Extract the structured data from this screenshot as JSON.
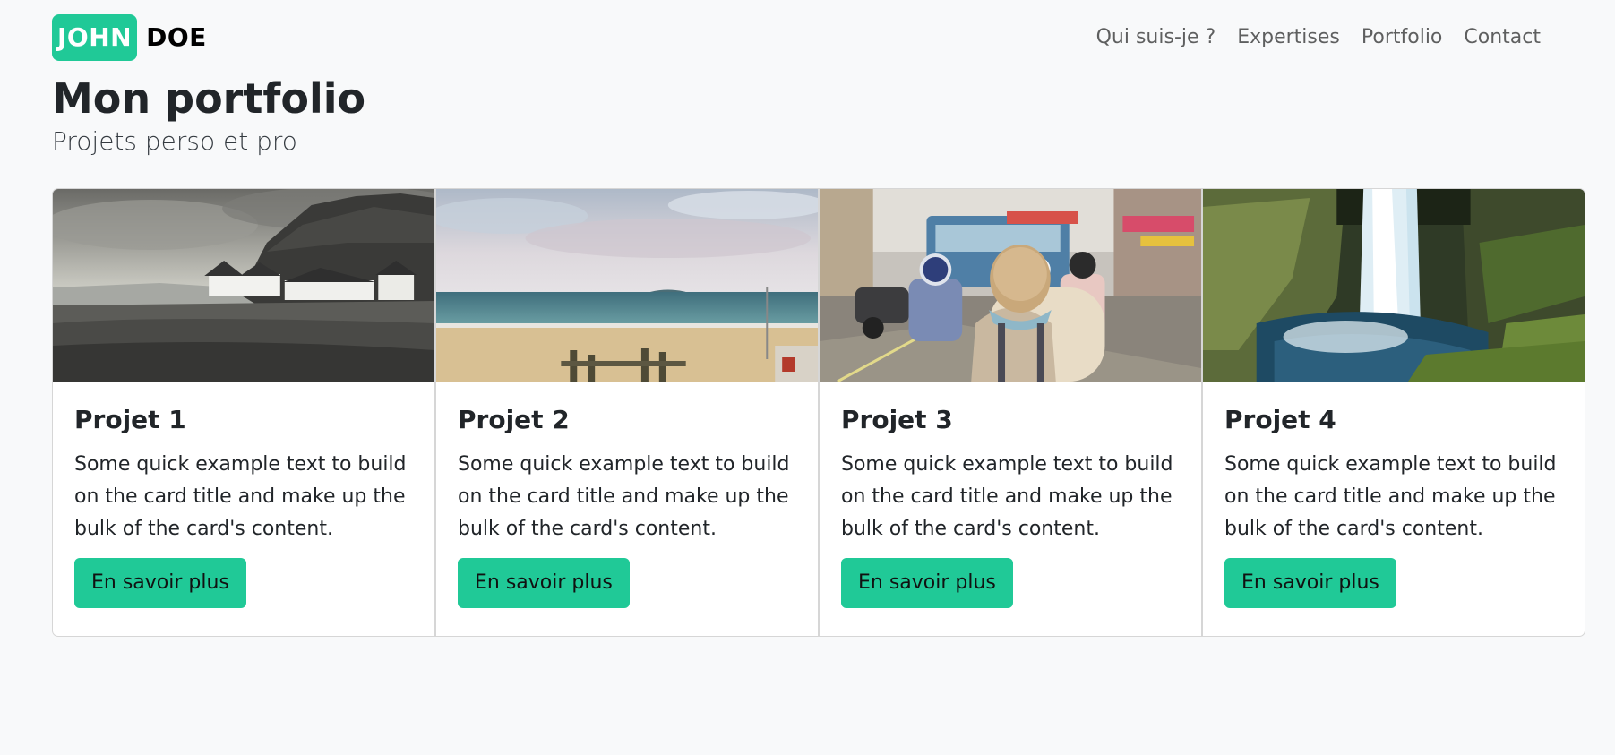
{
  "navbar": {
    "brand_first": "JOHN",
    "brand_last": "DOE",
    "links": [
      {
        "label": "Qui suis-je ?"
      },
      {
        "label": "Expertises"
      },
      {
        "label": "Portfolio"
      },
      {
        "label": "Contact"
      }
    ]
  },
  "header": {
    "title": "Mon portfolio",
    "subtitle": "Projets perso et pro"
  },
  "cards": [
    {
      "title": "Projet 1",
      "text": "Some quick example text to build on the card title and make up the bulk of the card's content.",
      "button": "En savoir plus"
    },
    {
      "title": "Projet 2",
      "text": "Some quick example text to build on the card title and make up the bulk of the card's content.",
      "button": "En savoir plus"
    },
    {
      "title": "Projet 3",
      "text": "Some quick example text to build on the card title and make up the bulk of the card's content.",
      "button": "En savoir plus"
    },
    {
      "title": "Projet 4",
      "text": "Some quick example text to build on the card title and make up the bulk of the card's content.",
      "button": "En savoir plus"
    }
  ],
  "colors": {
    "accent": "#20c997",
    "background": "#f8f9fa",
    "text": "#212529"
  }
}
